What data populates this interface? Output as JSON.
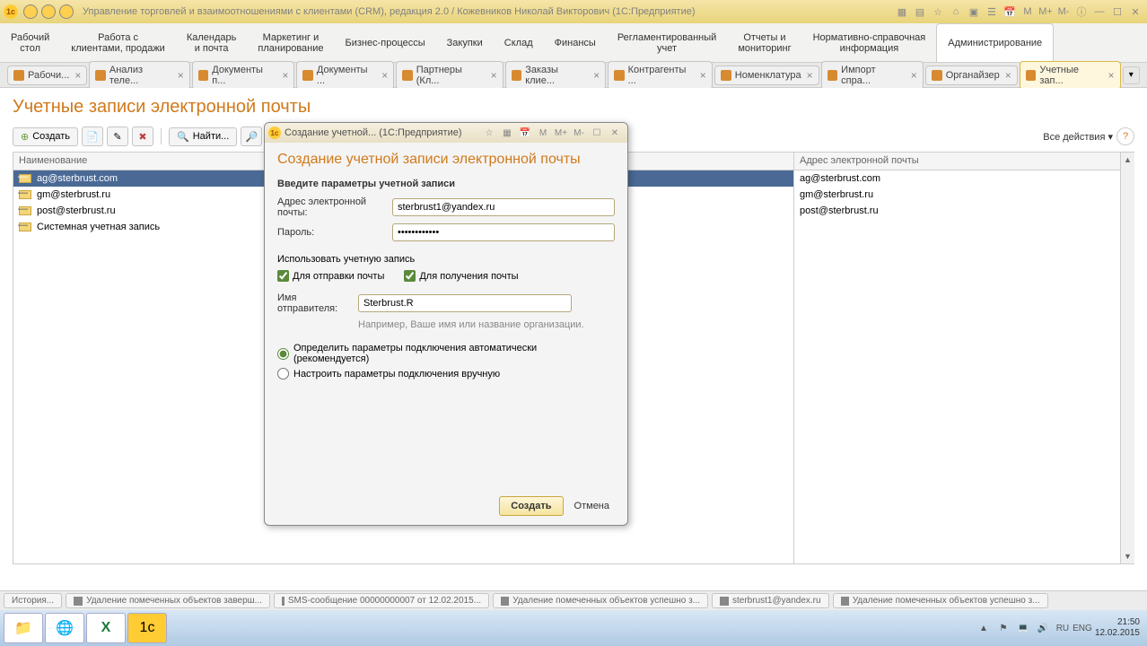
{
  "window": {
    "title": "Управление торговлей и взаимоотношениями с клиентами (CRM), редакция 2.0 / Кожевников Николай Викторович  (1С:Предприятие)"
  },
  "mainmenu": [
    "Рабочий\nстол",
    "Работа с\nклиентами, продажи",
    "Календарь\nи почта",
    "Маркетинг и\nпланирование",
    "Бизнес-процессы",
    "Закупки",
    "Склад",
    "Финансы",
    "Регламентированный\nучет",
    "Отчеты и\nмониторинг",
    "Нормативно-справочная\nинформация",
    "Администрирование"
  ],
  "mainmenu_active": 11,
  "tabs": [
    {
      "label": "Рабочи..."
    },
    {
      "label": "Анализ теле..."
    },
    {
      "label": "Документы п..."
    },
    {
      "label": "Документы ..."
    },
    {
      "label": "Партнеры (Кл..."
    },
    {
      "label": "Заказы клие..."
    },
    {
      "label": "Контрагенты ..."
    },
    {
      "label": "Номенклатура"
    },
    {
      "label": "Импорт спра..."
    },
    {
      "label": "Органайзер"
    },
    {
      "label": "Учетные зап..."
    }
  ],
  "tabs_active": 10,
  "page": {
    "title": "Учетные записи электронной почты",
    "create": "Создать",
    "search_placeholder": "Найти...",
    "all_actions": "Все действия"
  },
  "grid": {
    "col1": "Наименование",
    "col2": "Адрес электронной почты",
    "rows1": [
      "ag@sterbrust.com",
      "gm@sterbrust.ru",
      "post@sterbrust.ru",
      "Системная учетная запись"
    ],
    "rows2": [
      "ag@sterbrust.com",
      "gm@sterbrust.ru",
      "post@sterbrust.ru"
    ],
    "selected": 0
  },
  "modal": {
    "title": "Создание учетной...  (1С:Предприятие)",
    "heading": "Создание учетной записи электронной почты",
    "section1": "Введите параметры учетной записи",
    "email_label": "Адрес электронной почты:",
    "email_value": "sterbrust1@yandex.ru",
    "password_label": "Пароль:",
    "password_value": "xxxxxxxxxxxx",
    "use_label": "Использовать учетную запись",
    "cb_send": "Для отправки почты",
    "cb_recv": "Для получения почты",
    "sender_label": "Имя отправителя:",
    "sender_value": "Sterbrust.R",
    "sender_hint": "Например, Ваше имя или название организации.",
    "radio_auto": "Определить параметры подключения автоматически (рекомендуется)",
    "radio_manual": "Настроить параметры подключения вручную",
    "btn_create": "Создать",
    "btn_cancel": "Отмена"
  },
  "appbar": [
    "История...",
    "Удаление помеченных объектов заверш...",
    "SMS-сообщение 00000000007 от 12.02.2015...",
    "Удаление помеченных объектов успешно з...",
    "sterbrust1@yandex.ru",
    "Удаление помеченных объектов успешно з..."
  ],
  "tray": {
    "lang": "RU",
    "kb": "ENG",
    "time": "21:50",
    "date": "12.02.2015"
  }
}
